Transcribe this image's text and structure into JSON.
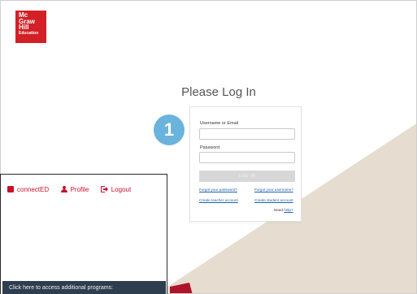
{
  "brand": {
    "logo_lines": [
      "Mc",
      "Graw",
      "Hill"
    ],
    "logo_sub": "Education",
    "color": "#d31f26"
  },
  "login": {
    "title": "Please Log In",
    "username_label": "Username or Email",
    "password_label": "Password",
    "login_button": "LOG IN",
    "forgot_password": "Forgot your password?",
    "forgot_username": "Forgot your username?",
    "create_teacher": "Create teacher account",
    "create_student": "Create student account",
    "need_text": "Need",
    "help_link": "help?",
    "link_color": "#1f62a8"
  },
  "step_badge": {
    "number": "1",
    "color": "#6ab3dc"
  },
  "popup": {
    "nav": [
      {
        "label": "connectED",
        "icon": "connected-icon"
      },
      {
        "label": "Profile",
        "icon": "profile-icon"
      },
      {
        "label": "Logout",
        "icon": "logout-icon"
      }
    ],
    "nav_color": "#c8102e",
    "programs_text": "Click here to access additional programs:",
    "programs_bar_color": "#2f3e4f"
  },
  "background": {
    "beige": "#e6ddd0",
    "red_accent": "#b0142a"
  }
}
